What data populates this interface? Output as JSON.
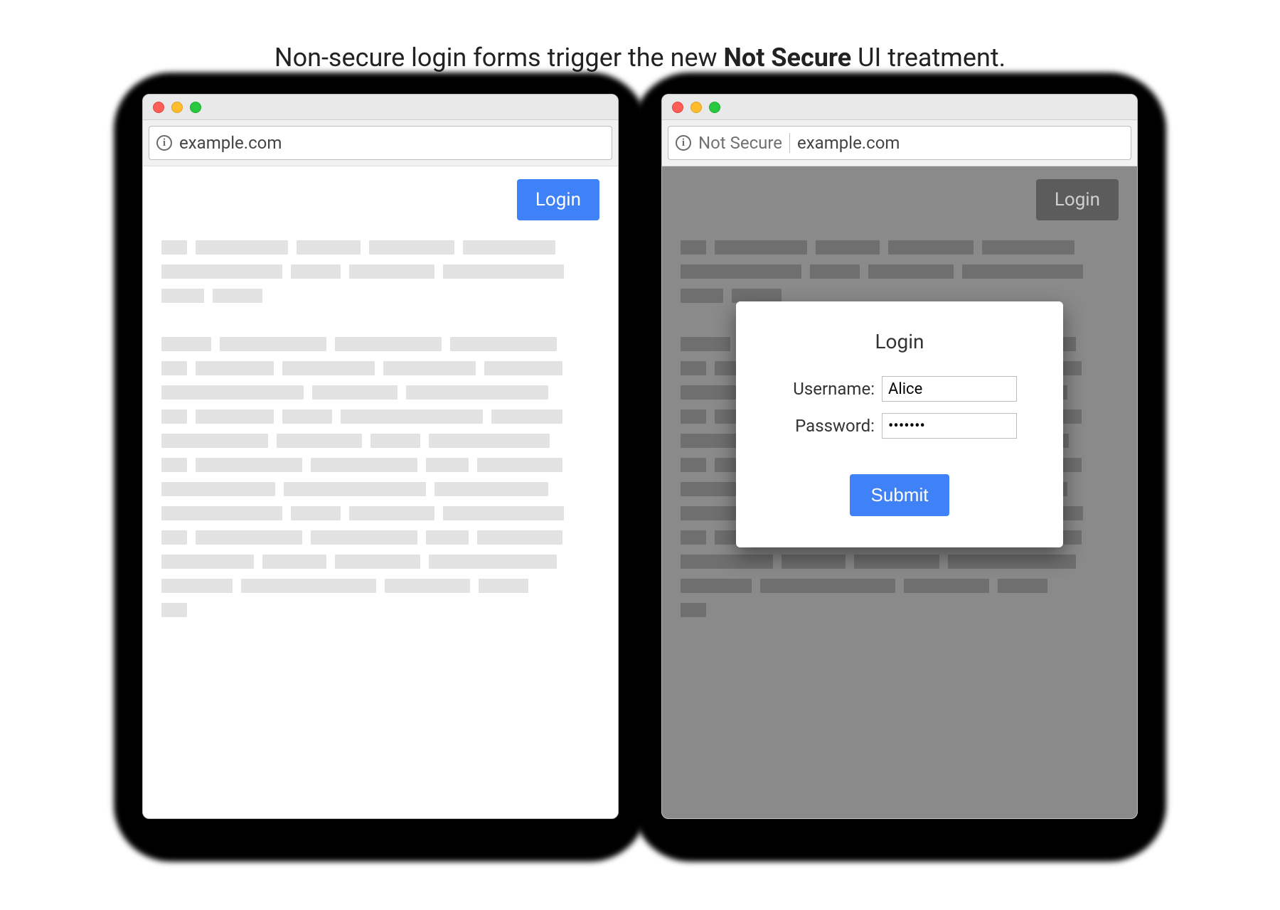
{
  "caption": {
    "prefix": "Non-secure login forms trigger the new ",
    "bold": "Not Secure",
    "suffix": " UI treatment."
  },
  "left": {
    "address": "example.com",
    "login_chip": "Login"
  },
  "right": {
    "not_secure_label": "Not Secure",
    "address": "example.com",
    "login_chip": "Login",
    "modal": {
      "title": "Login",
      "username_label": "Username:",
      "username_value": "Alice",
      "password_label": "Password:",
      "password_value": "•••••••",
      "submit_label": "Submit"
    }
  },
  "colors": {
    "accent_blue": "#3f82f8",
    "dim_bg": "#8a8a8a"
  }
}
